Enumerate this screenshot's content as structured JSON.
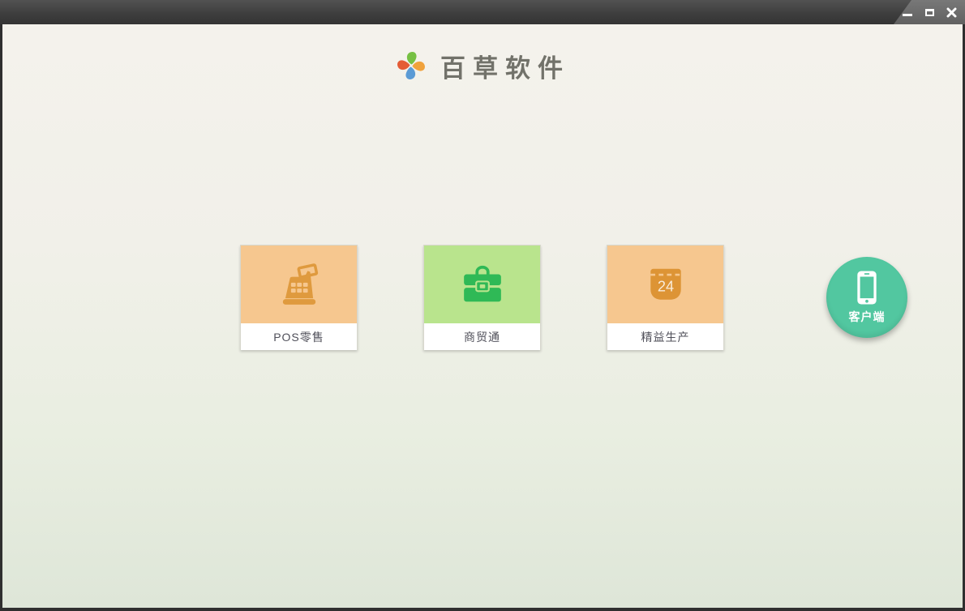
{
  "window": {
    "controls": {
      "minimize": "minimize",
      "maximize": "maximize",
      "close": "close"
    }
  },
  "header": {
    "app_title": "百草软件",
    "logo": "pinwheel-logo"
  },
  "products": [
    {
      "label": "POS零售",
      "icon": "cash-register-icon",
      "tile_color": "#f6c78f",
      "icon_color": "#df9a3e"
    },
    {
      "label": "商贸通",
      "icon": "briefcase-icon",
      "tile_color": "#b9e48d",
      "icon_color": "#2fb956"
    },
    {
      "label": "精益生产",
      "icon": "calendar-icon",
      "tile_color": "#f6c78f",
      "icon_color": "#dd9435",
      "calendar_day": "24"
    }
  ],
  "client_button": {
    "label": "客户端",
    "icon": "smartphone-icon",
    "color": "#52c7a0"
  },
  "colors": {
    "titlebar": "#3e3e3e",
    "background_top": "#f4f2ec",
    "background_bottom": "#dee6d8",
    "title_text": "#72726a",
    "label_text": "#50505a"
  }
}
